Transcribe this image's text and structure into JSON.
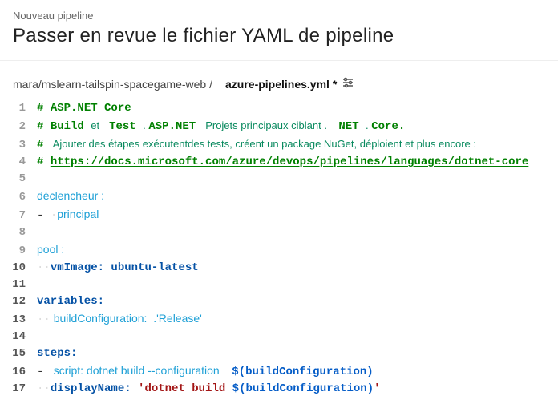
{
  "header": {
    "subLabel": "Nouveau pipeline",
    "title": "Passer en revue le fichier YAML de pipeline"
  },
  "breadcrumb": {
    "path": "mara/mslearn-tailspin-spacegame-web /",
    "file": "azure-pipelines.yml",
    "modified": "*"
  },
  "lines": {
    "l1": {
      "hash": "# ",
      "text": "ASP.NET Core"
    },
    "l2": {
      "hash": "# ",
      "b1": "Build ",
      "t1": "et ",
      "b2": " Test ",
      "t2": ". ",
      "b3": "ASP.NET ",
      "t3": " Projets principaux ciblant",
      "t4": " .    ",
      "b4": "NET ",
      "t5": ". ",
      "b5": "Core."
    },
    "l3": {
      "hash": "# ",
      "t1": " Ajouter des étap",
      "t2": "es ",
      "t3": "exécutent",
      "t4": "des tests, créent un package NuGet, déploient et plus encore :"
    },
    "l4": {
      "hash": "# ",
      "link": "https://docs.microsoft.com/azure/devops/pipelines/languages/dotnet-core"
    },
    "l6": {
      "key": "déclencheur :"
    },
    "l7": {
      "dash": "- ",
      "val": "principal"
    },
    "l9": {
      "key": "pool :"
    },
    "l10": {
      "key": "vmImage:",
      "val": " ubuntu-latest"
    },
    "l12": {
      "key": "variables:"
    },
    "l13": {
      "key": " buildConfiguration: ",
      "val": " .'Release'"
    },
    "l15": {
      "key": "steps:"
    },
    "l16": {
      "dash": "- ",
      "key": " script: dotnet build --configuration    ",
      "expr": "$(buildConfiguration)"
    },
    "l17": {
      "key": "displayName:",
      "str": " 'dotnet build ",
      "expr": "$(buildConfiguration)",
      "str2": "'"
    }
  }
}
